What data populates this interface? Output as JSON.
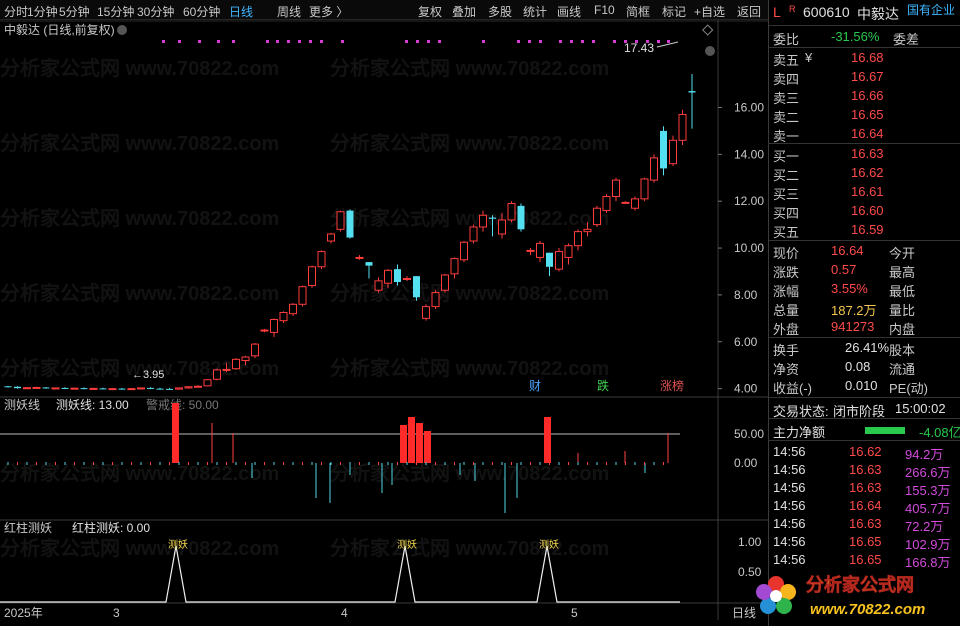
{
  "toolbar": {
    "items": [
      "分时",
      "1分钟",
      "5分钟",
      "15分钟",
      "30分钟",
      "60分钟",
      "日线",
      "周线",
      "更多 〉",
      "复权",
      "叠加",
      "多股",
      "统计",
      "画线",
      "F10",
      "简框",
      "标记",
      "+自选",
      "返回"
    ],
    "active": "日线"
  },
  "main_chart": {
    "title": "中毅达 (日线,前复权)",
    "high_label": "17.43",
    "low_label": "←3.95",
    "price_ticks": [
      "16.00",
      "14.00",
      "12.00",
      "10.00",
      "8.00",
      "6.00",
      "4.00"
    ],
    "markers": [
      "财",
      "跌",
      "涨榜"
    ]
  },
  "indicator1": {
    "title": "测妖线",
    "value_label": "测妖线: 13.00",
    "warn_label": "警戒线: 50.00",
    "ticks": [
      "50.00",
      "0.00"
    ]
  },
  "indicator2": {
    "title": "红柱测妖",
    "value_label": "红柱测妖: 0.00",
    "signal_label": "测妖",
    "ticks": [
      "1.00",
      "0.50"
    ]
  },
  "x_axis": {
    "labels": [
      "2025年",
      "3",
      "4",
      "5"
    ],
    "corner": "日线"
  },
  "watermark": "分析家公式网 www.70822.com",
  "chart_data": {
    "type": "candlestick",
    "title": "中毅达 (日线,前复权)",
    "ylim": [
      3.6,
      17.6
    ],
    "ohlc": [
      [
        4.1,
        4.12,
        4.05,
        4.08
      ],
      [
        4.08,
        4.1,
        4.0,
        4.02
      ],
      [
        4.02,
        4.06,
        3.98,
        4.04
      ],
      [
        4.04,
        4.08,
        4.0,
        4.05
      ],
      [
        4.05,
        4.07,
        4.0,
        4.01
      ],
      [
        4.01,
        4.05,
        3.98,
        4.03
      ],
      [
        4.03,
        4.06,
        3.99,
        4.0
      ],
      [
        4.0,
        4.04,
        3.97,
        4.02
      ],
      [
        4.02,
        4.05,
        3.98,
        4.0
      ],
      [
        4.0,
        4.03,
        3.96,
        4.01
      ],
      [
        4.01,
        4.04,
        3.97,
        3.99
      ],
      [
        3.99,
        4.02,
        3.95,
        4.0
      ],
      [
        4.0,
        4.03,
        3.96,
        3.98
      ],
      [
        3.98,
        4.02,
        3.95,
        4.0
      ],
      [
        4.0,
        4.05,
        3.97,
        4.03
      ],
      [
        4.03,
        4.06,
        3.98,
        4.0
      ],
      [
        4.0,
        4.04,
        3.96,
        3.99
      ],
      [
        3.99,
        4.02,
        3.95,
        3.98
      ],
      [
        3.98,
        4.05,
        3.95,
        4.03
      ],
      [
        4.03,
        4.1,
        4.0,
        4.08
      ],
      [
        4.08,
        4.15,
        4.05,
        4.1
      ],
      [
        4.12,
        4.4,
        4.1,
        4.38
      ],
      [
        4.4,
        4.85,
        4.35,
        4.8
      ],
      [
        4.8,
        5.1,
        4.7,
        4.82
      ],
      [
        4.85,
        5.3,
        4.8,
        5.25
      ],
      [
        5.2,
        5.4,
        5.0,
        5.35
      ],
      [
        5.4,
        5.95,
        5.3,
        5.9
      ],
      [
        6.5,
        6.55,
        6.4,
        6.5
      ],
      [
        6.4,
        7.0,
        6.2,
        6.95
      ],
      [
        6.9,
        7.3,
        6.8,
        7.25
      ],
      [
        7.2,
        7.65,
        7.1,
        7.6
      ],
      [
        7.6,
        8.4,
        7.5,
        8.35
      ],
      [
        8.4,
        9.25,
        8.3,
        9.2
      ],
      [
        9.2,
        9.9,
        9.1,
        9.85
      ],
      [
        10.3,
        10.65,
        10.2,
        10.6
      ],
      [
        10.8,
        11.6,
        10.7,
        11.55
      ],
      [
        11.6,
        11.65,
        10.4,
        10.45
      ],
      [
        9.6,
        9.7,
        9.5,
        9.6
      ],
      [
        9.4,
        9.4,
        8.7,
        9.25
      ],
      [
        8.2,
        8.75,
        8.1,
        8.6
      ],
      [
        8.5,
        9.1,
        8.3,
        9.05
      ],
      [
        9.1,
        9.3,
        8.4,
        8.55
      ],
      [
        8.7,
        8.8,
        8.6,
        8.7
      ],
      [
        8.8,
        8.8,
        7.75,
        7.9
      ],
      [
        7.0,
        7.6,
        6.9,
        7.5
      ],
      [
        7.5,
        8.2,
        7.4,
        8.1
      ],
      [
        8.2,
        8.9,
        8.1,
        8.85
      ],
      [
        8.9,
        9.6,
        8.7,
        9.55
      ],
      [
        9.5,
        10.3,
        9.4,
        10.25
      ],
      [
        10.3,
        11.0,
        10.2,
        10.9
      ],
      [
        10.9,
        11.6,
        10.7,
        11.4
      ],
      [
        11.3,
        11.4,
        10.5,
        11.25
      ],
      [
        10.6,
        11.5,
        10.4,
        11.2
      ],
      [
        11.2,
        12.0,
        11.1,
        11.9
      ],
      [
        11.8,
        11.9,
        10.7,
        10.8
      ],
      [
        9.9,
        10.0,
        9.7,
        9.9
      ],
      [
        9.6,
        10.3,
        9.4,
        10.2
      ],
      [
        9.8,
        9.8,
        8.8,
        9.2
      ],
      [
        9.1,
        10.0,
        9.0,
        9.85
      ],
      [
        9.6,
        10.2,
        9.3,
        10.1
      ],
      [
        10.1,
        10.8,
        9.9,
        10.7
      ],
      [
        10.7,
        11.1,
        10.5,
        10.8
      ],
      [
        11.0,
        11.8,
        10.9,
        11.7
      ],
      [
        11.6,
        12.3,
        11.5,
        12.2
      ],
      [
        12.2,
        13.0,
        12.0,
        12.9
      ],
      [
        11.95,
        12.0,
        11.9,
        11.95
      ],
      [
        11.7,
        12.2,
        11.6,
        12.1
      ],
      [
        12.1,
        13.0,
        12.0,
        12.95
      ],
      [
        12.9,
        14.0,
        12.8,
        13.85
      ],
      [
        15.0,
        15.2,
        13.1,
        13.4
      ],
      [
        13.6,
        14.8,
        13.5,
        14.6
      ],
      [
        14.6,
        15.9,
        14.4,
        15.7
      ],
      [
        16.7,
        17.43,
        15.1,
        16.64
      ]
    ]
  },
  "right": {
    "code": "600610",
    "name": "中毅达",
    "tag": "国有企业",
    "commission": {
      "label": "委比",
      "value": "-31.56%",
      "diff_label": "委差"
    },
    "asks": [
      [
        "卖五",
        "¥",
        "16.68"
      ],
      [
        "卖四",
        "",
        "16.67"
      ],
      [
        "卖三",
        "",
        "16.66"
      ],
      [
        "卖二",
        "",
        "16.65"
      ],
      [
        "卖一",
        "",
        "16.64"
      ]
    ],
    "bids": [
      [
        "买一",
        "16.63"
      ],
      [
        "买二",
        "16.62"
      ],
      [
        "买三",
        "16.61"
      ],
      [
        "买四",
        "16.60"
      ],
      [
        "买五",
        "16.59"
      ]
    ],
    "quote": [
      [
        "现价",
        "16.64",
        "今开"
      ],
      [
        "涨跌",
        "0.57",
        "最高"
      ],
      [
        "涨幅",
        "3.55%",
        "最低"
      ],
      [
        "总量",
        "187.2万",
        "量比"
      ],
      [
        "外盘",
        "941273",
        "内盘"
      ]
    ],
    "quote2": [
      [
        "换手",
        "26.41%",
        "股本"
      ],
      [
        "净资",
        "0.08",
        "流通"
      ],
      [
        "收益(-)",
        "0.010",
        "PE(动)"
      ]
    ],
    "status": {
      "label": "交易状态:",
      "value": "闭市阶段",
      "time": "15:00:02"
    },
    "flow": {
      "label": "主力净额",
      "value": "-4.08亿"
    },
    "ticks": [
      [
        "14:56",
        "16.62",
        "94.2万"
      ],
      [
        "14:56",
        "16.63",
        "266.6万"
      ],
      [
        "14:56",
        "16.63",
        "155.3万"
      ],
      [
        "14:56",
        "16.64",
        "405.7万"
      ],
      [
        "14:56",
        "16.63",
        "72.2万"
      ],
      [
        "14:56",
        "16.65",
        "102.9万"
      ],
      [
        "14:56",
        "16.65",
        "166.8万"
      ]
    ]
  },
  "logo": {
    "text": "分析家公式网",
    "url": "www.70822.com"
  }
}
